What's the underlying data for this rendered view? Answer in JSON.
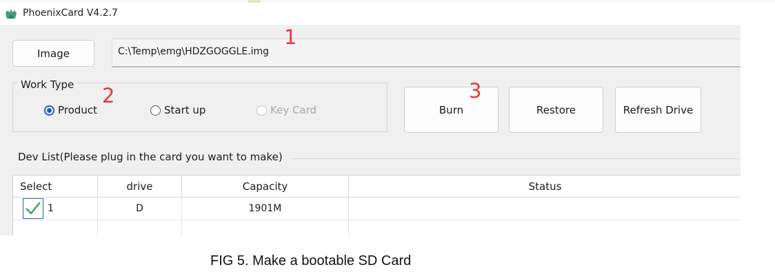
{
  "window": {
    "title": "PhoenixCard V4.2.7",
    "icon": "phoenix-app-icon"
  },
  "image": {
    "button_label": "Image",
    "path": "C:\\Temp\\emg\\HDZGOGGLE.img"
  },
  "work_type": {
    "title": "Work Type",
    "options": [
      {
        "label": "Product",
        "selected": true,
        "enabled": true
      },
      {
        "label": "Start up",
        "selected": false,
        "enabled": true
      },
      {
        "label": "Key Card",
        "selected": false,
        "enabled": false
      }
    ]
  },
  "actions": {
    "burn": "Burn",
    "restore": "Restore",
    "refresh": "Refresh Drive"
  },
  "dev_list": {
    "title": "Dev List(Please plug in the card you want to make)",
    "columns": [
      "Select",
      "drive",
      "Capacity",
      "Status"
    ],
    "rows": [
      {
        "selected": true,
        "index": "1",
        "drive": "D",
        "capacity": "1901M",
        "status": ""
      }
    ]
  },
  "annotations": [
    "1",
    "2",
    "3"
  ],
  "caption": "FIG 5. Make a bootable SD Card",
  "colors": {
    "annotation": "#e23b3b",
    "accent": "#1f5fad",
    "checkmark": "#3aa655"
  }
}
